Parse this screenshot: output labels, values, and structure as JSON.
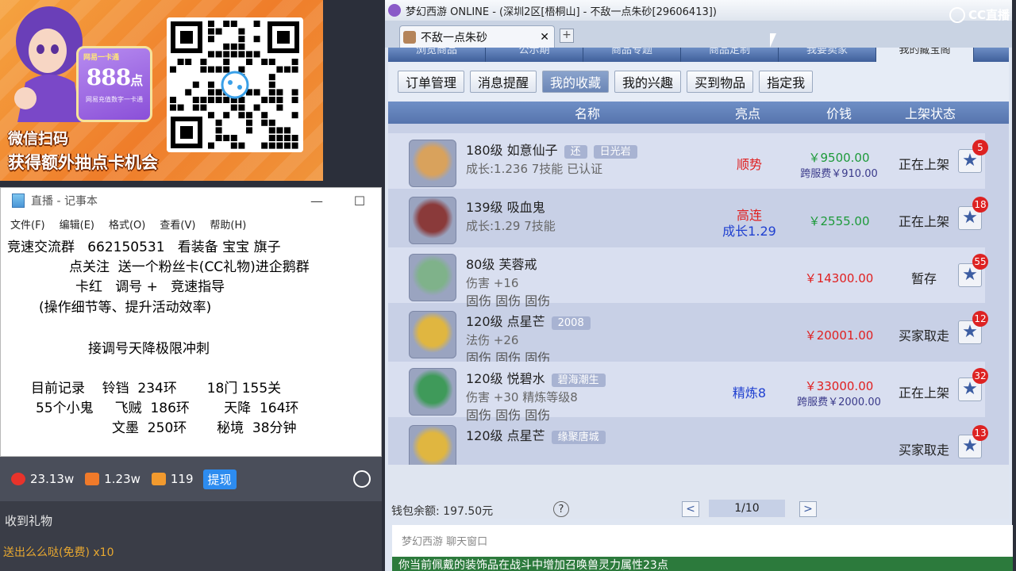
{
  "ad": {
    "card_brand": "网易一卡通",
    "card_amount": "888",
    "card_unit": "点",
    "card_caption": "网易充值数字一卡通",
    "slogan_1": "微信扫码",
    "slogan_2": "获得额外抽点卡机会"
  },
  "notepad": {
    "title": "直播 - 记事本",
    "controls": [
      "—",
      "☐"
    ],
    "menu": [
      "文件(F)",
      "编辑(E)",
      "格式(O)",
      "查看(V)",
      "帮助(H)"
    ],
    "lines": [
      "竞速交流群   662150531   看装备 宝宝 旗子",
      "点关注  送一个粉丝卡(CC礼物)进企鹅群",
      "卡红   调号 +   竞速指导",
      "(操作细节等、提升活动效率)",
      "接调号天降极限冲刺",
      "目前记录    铃铛  234环       18门 155关",
      "55个小鬼     飞贼  186环        天降  164环",
      "文墨  250环       秘境  38分钟"
    ]
  },
  "stats": {
    "hot": "23.13w",
    "fans": "1.23w",
    "gifts": "119",
    "withdraw_label": "提现"
  },
  "gifts": {
    "title": "收到礼物",
    "line": "送出么么哒(免费)  x10"
  },
  "game": {
    "title": "梦幻西游 ONLINE - (深圳2区[梧桐山] - 不敌一点朱砂[29606413])",
    "tab_label": "不敌一点朱砂",
    "tab_close": "✕",
    "plus": "+",
    "top_tabs": [
      "浏览商品",
      "公示期",
      "商品专题",
      "商品定制",
      "我要卖家",
      "我的藏宝阁"
    ],
    "buttons": [
      "订单管理",
      "消息提醒",
      "我的收藏",
      "我的兴趣",
      "买到物品",
      "指定我"
    ],
    "active_button": 2,
    "headers": [
      "名称",
      "亮点",
      "价钱",
      "上架状态"
    ],
    "rows": [
      {
        "line1": "180级  如意仙子",
        "tag": "还",
        "tag2": "日光岩",
        "line2": "成长:1.236  7技能  已认证",
        "line3": "",
        "hl": "顺势",
        "hl2": "",
        "price": "￥9500.00",
        "price2": "跨服费￥910.00",
        "status": "正在上架",
        "badge": "5"
      },
      {
        "line1": "139级  吸血鬼",
        "tag": "",
        "tag2": "",
        "line2": "成长:1.29  7技能",
        "line3": "",
        "hl": "高连",
        "hl2": "成长1.29",
        "price": "￥2555.00",
        "price2": "",
        "status": "正在上架",
        "badge": "18"
      },
      {
        "line1": "80级  芙蓉戒",
        "tag": "",
        "tag2": "",
        "line2": "伤害 +16",
        "line3": "固伤  固伤  固伤",
        "hl": "",
        "hl2": "",
        "price": "￥14300.00",
        "price2": "",
        "status": "暂存",
        "badge": "55"
      },
      {
        "line1": "120级  点星芒",
        "tag": "2008",
        "tag2": "",
        "line2": "法伤 +26",
        "line3": "固伤  固伤  固伤",
        "hl": "",
        "hl2": "",
        "price": "￥20001.00",
        "price2": "",
        "status": "买家取走",
        "badge": "12"
      },
      {
        "line1": "120级  悦碧水",
        "tag": "碧海潮生",
        "tag2": "",
        "line2": "伤害 +30  精炼等级8",
        "line3": "固伤  固伤  固伤",
        "hl": "精炼8",
        "hl2": "",
        "price": "￥33000.00",
        "price2": "跨服费￥2000.00",
        "status": "正在上架",
        "badge": "32"
      },
      {
        "line1": "120级  点星芒",
        "tag": "缘聚唐城",
        "tag2": "",
        "line2": "",
        "line3": "",
        "hl": "",
        "hl2": "",
        "price": "",
        "price2": "",
        "status": "买家取走",
        "badge": "13"
      }
    ],
    "balance": "钱包余额: 197.50元",
    "help": "?",
    "prev": "<",
    "next": ">",
    "page": "1/10",
    "chat_title": "梦幻西游 聊天窗口",
    "chat_msg": "你当前佩戴的装饰品在战斗中增加召唤兽灵力属性23点"
  },
  "cc_logo": "CC直播",
  "colors": {
    "accent_red": "#e02020",
    "accent_blue": "#2040d0",
    "price_green": "#1d9a3a",
    "badge_red": "#d22"
  }
}
